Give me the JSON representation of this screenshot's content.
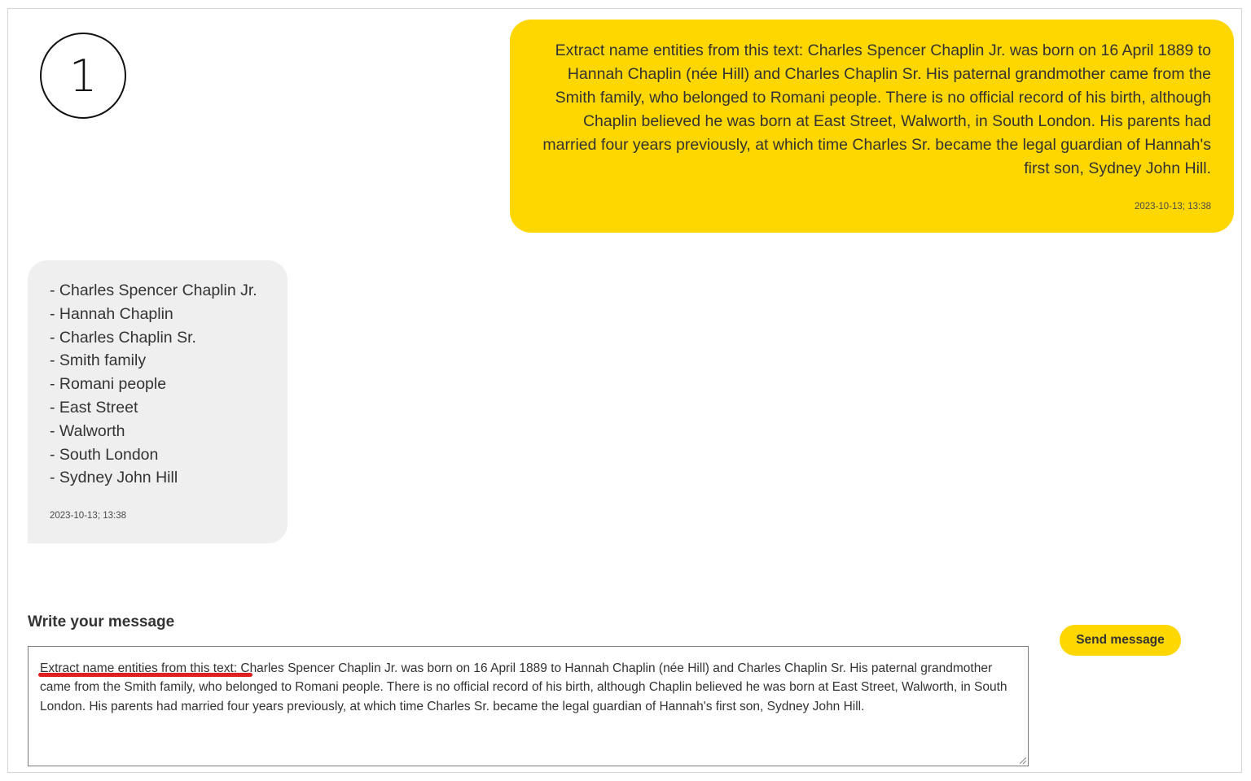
{
  "step": {
    "number": "1"
  },
  "conversation": {
    "user_message": {
      "text": "Extract name entities from this text: Charles Spencer Chaplin Jr. was born on 16 April 1889 to Hannah Chaplin (née Hill) and Charles Chaplin Sr. His paternal grandmother came from the Smith family, who belonged to Romani people. There is no official record of his birth, although Chaplin believed he was born at East Street, Walworth, in South London. His parents had married four years previously, at which time Charles Sr. became the legal guardian of Hannah's first son, Sydney John Hill.",
      "timestamp": "2023-10-13; 13:38"
    },
    "bot_message": {
      "entities": [
        "- Charles Spencer Chaplin Jr.",
        "- Hannah Chaplin",
        "- Charles Chaplin Sr.",
        "- Smith family",
        "- Romani people",
        "- East Street",
        "- Walworth",
        "- South London",
        "- Sydney John Hill"
      ],
      "timestamp": "2023-10-13; 13:38"
    }
  },
  "composer": {
    "label": "Write your message",
    "value_highlight": "Extract name entities from this text:",
    "value_rest": " Charles Spencer Chaplin Jr. was born on 16 April 1889 to Hannah Chaplin (née Hill) and Charles Chaplin Sr. His paternal grandmother came from the Smith family, who belonged to Romani people. There is no official record of his birth, although Chaplin believed he was born at East Street, Walworth, in South London. His parents had married four years previously, at which time Charles Sr. became the legal guardian of Hannah's first son, Sydney John Hill.",
    "send_label": "Send message"
  },
  "colors": {
    "accent_yellow": "#ffd700",
    "bot_bubble": "#efefef",
    "annotation_red": "#e02020"
  },
  "icons": {
    "resize": "resize-handle-icon"
  }
}
